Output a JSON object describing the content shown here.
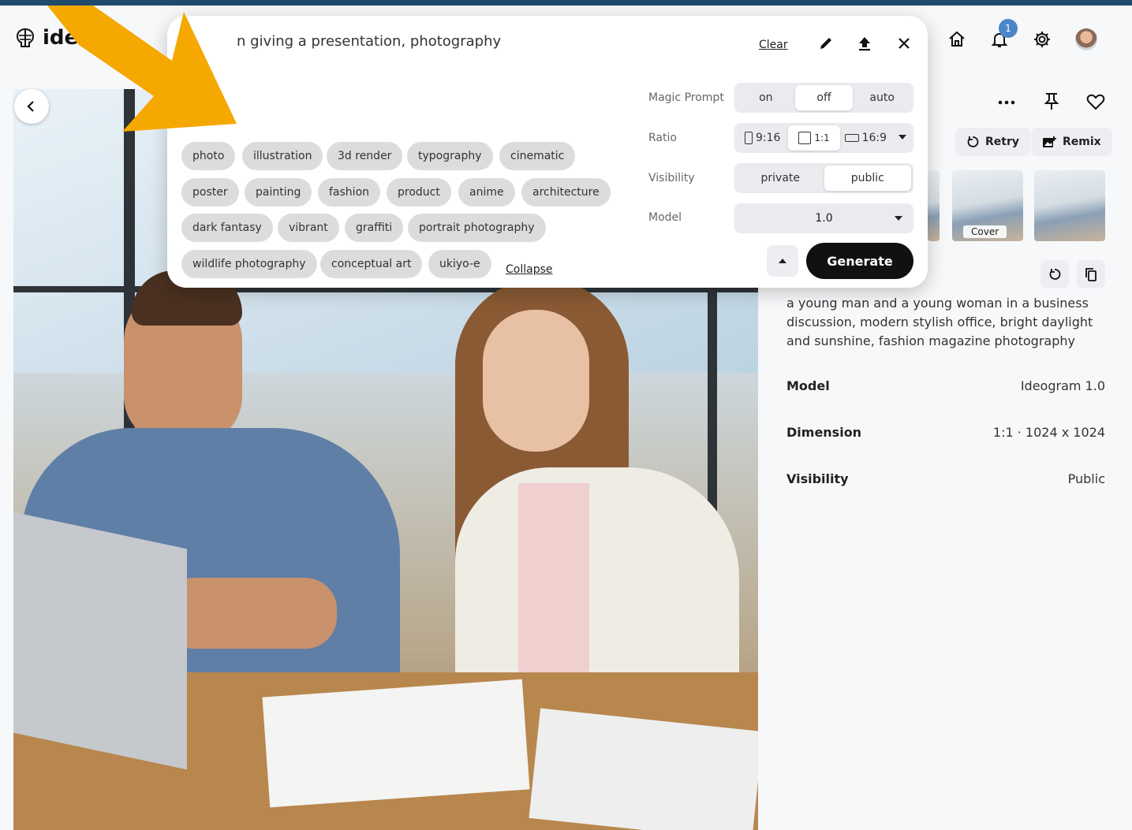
{
  "header": {
    "logo_text": "ideo",
    "notification_count": "1"
  },
  "prompt_panel": {
    "prompt_text": "n giving a presentation, photography",
    "clear_label": "Clear",
    "tags": [
      "photo",
      "illustration",
      "3d render",
      "typography",
      "cinematic",
      "poster",
      "painting",
      "fashion",
      "product",
      "anime",
      "architecture",
      "dark fantasy",
      "vibrant",
      "graffiti",
      "portrait photography",
      "wildlife photography",
      "conceptual art",
      "ukiyo-e"
    ],
    "collapse_label": "Collapse",
    "magic_prompt": {
      "label": "Magic Prompt",
      "options": [
        "on",
        "off",
        "auto"
      ],
      "selected": "off"
    },
    "ratio": {
      "label": "Ratio",
      "options": [
        "9:16",
        "1:1",
        "16:9"
      ],
      "selected": "1:1"
    },
    "visibility": {
      "label": "Visibility",
      "options": [
        "private",
        "public"
      ],
      "selected": "public"
    },
    "model": {
      "label": "Model",
      "value": "1.0"
    },
    "generate_label": "Generate"
  },
  "details": {
    "retry_label": "Retry",
    "remix_label": "Remix",
    "cover_label": "Cover",
    "description": "a young man and a young woman in a business discussion, modern stylish office, bright daylight and sunshine, fashion magazine photography",
    "meta": [
      {
        "key": "Model",
        "value": "Ideogram 1.0"
      },
      {
        "key": "Dimension",
        "value": "1:1 · 1024 x 1024"
      },
      {
        "key": "Visibility",
        "value": "Public"
      }
    ]
  },
  "colors": {
    "frame": "#1f4a6b",
    "annotation_arrow": "#f5a800",
    "badge": "#4a86c8",
    "generate_button": "#111111"
  }
}
